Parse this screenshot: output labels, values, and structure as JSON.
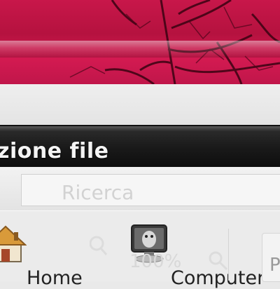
{
  "window": {
    "title": "zione file"
  },
  "search": {
    "placeholder": "Ricerca"
  },
  "places": [
    {
      "label": "Home",
      "icon": "home-icon"
    },
    {
      "label": "Computer",
      "icon": "computer-icon"
    }
  ],
  "zoom": {
    "value": "100%"
  },
  "extra_item": {
    "label": "P"
  },
  "colors": {
    "wallpaper": "#c8174a",
    "titlebar": "#1a1a1a",
    "title_text": "#f4f4f4",
    "panel": "#e9e9e9"
  }
}
